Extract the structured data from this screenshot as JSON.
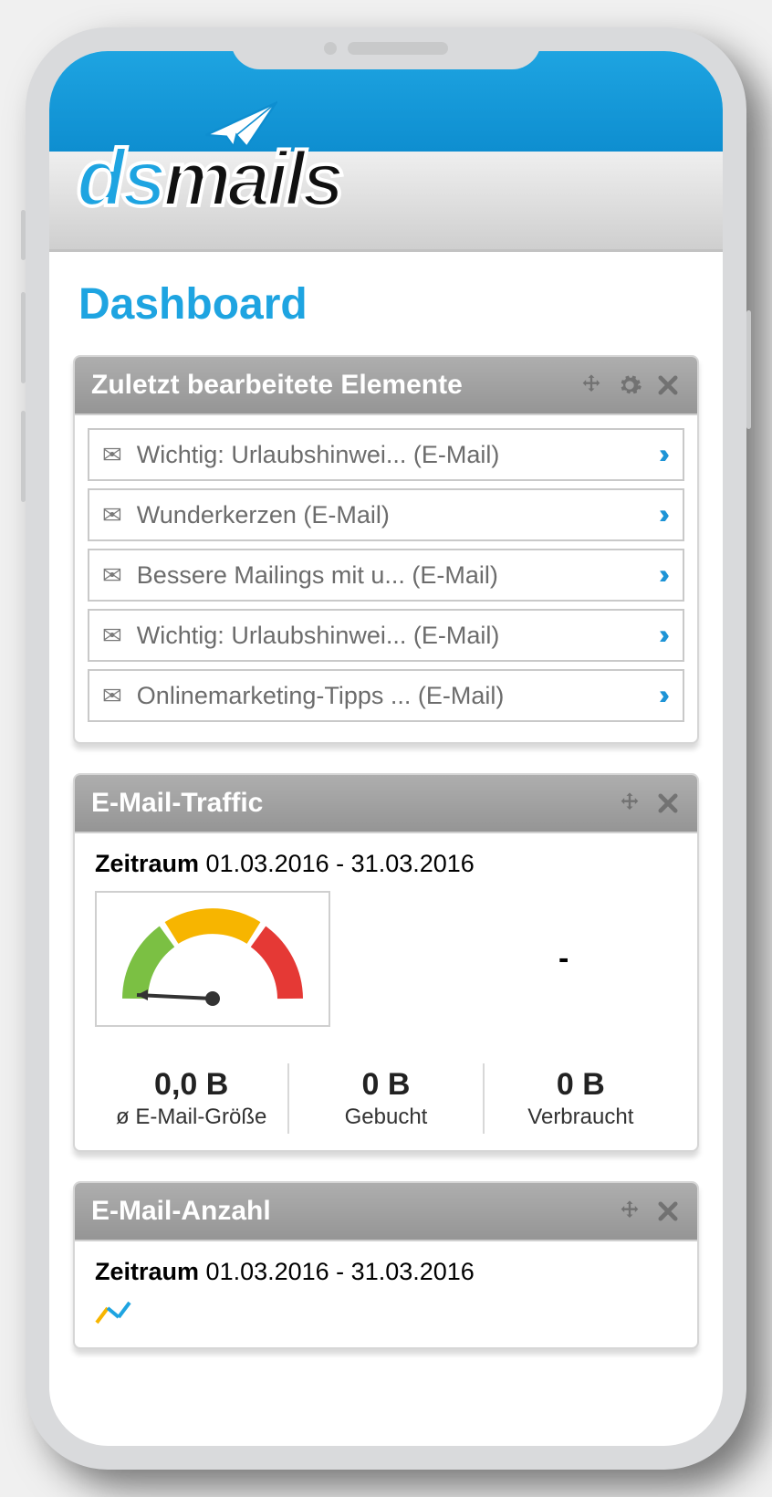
{
  "brand": {
    "part1": "ds",
    "part2": "mails"
  },
  "page_title": "Dashboard",
  "widgets": {
    "recent": {
      "title": "Zuletzt bearbeitete Elemente",
      "items": [
        "Wichtig: Urlaubshinwei... (E-Mail)",
        "Wunderkerzen (E-Mail)",
        "Bessere Mailings mit u... (E-Mail)",
        "Wichtig: Urlaubshinwei... (E-Mail)",
        "Onlinemarketing-Tipps ... (E-Mail)"
      ]
    },
    "traffic": {
      "title": "E-Mail-Traffic",
      "period_label": "Zeitraum",
      "period_value": "01.03.2016 - 31.03.2016",
      "dash": "-",
      "stats": [
        {
          "value": "0,0 B",
          "label": "ø E-Mail-Größe"
        },
        {
          "value": "0 B",
          "label": "Gebucht"
        },
        {
          "value": "0 B",
          "label": "Verbraucht"
        }
      ]
    },
    "count": {
      "title": "E-Mail-Anzahl",
      "period_label": "Zeitraum",
      "period_value": "01.03.2016 - 31.03.2016"
    }
  },
  "chart_data": {
    "type": "gauge",
    "title": "E-Mail-Traffic",
    "value": 0,
    "min": 0,
    "max": 100,
    "zones": [
      {
        "color": "#7bc043",
        "from": 0,
        "to": 33
      },
      {
        "color": "#f7b500",
        "from": 33,
        "to": 66
      },
      {
        "color": "#e53935",
        "from": 66,
        "to": 100
      }
    ]
  }
}
